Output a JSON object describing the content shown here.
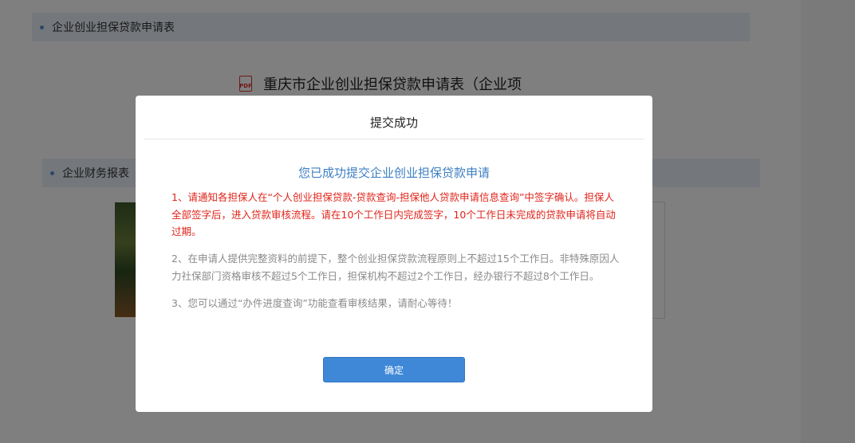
{
  "page": {
    "section1_title": "企业创业担保贷款申请表",
    "doc_icon_label": "PDF",
    "doc_title": "重庆市企业创业担保贷款申请表（企业项",
    "section2_title": "企业财务报表"
  },
  "modal": {
    "title": "提交成功",
    "headline": "您已成功提交企业创业担保贷款申请",
    "message_red": "1、请通知各担保人在“个人创业担保贷款-贷款查询-担保他人贷款申请信息查询”中签字确认。担保人全部签字后，进入贷款审核流程。请在10个工作日内完成签字，10个工作日未完成的贷款申请将自动过期。",
    "message_2": "2、在申请人提供完整资料的前提下，整个创业担保贷款流程原则上不超过15个工作日。非特殊原因人力社保部门资格审核不超过5个工作日，担保机构不超过2个工作日，经办银行不超过8个工作日。",
    "message_3": "3、您可以通过“办件进度查询”功能查看审核结果，请耐心等待！",
    "confirm_label": "确定"
  },
  "colors": {
    "accent": "#3f88d8",
    "headline": "#3d7fc2",
    "warning": "#e0241b",
    "section_bg": "#e9eff7"
  }
}
